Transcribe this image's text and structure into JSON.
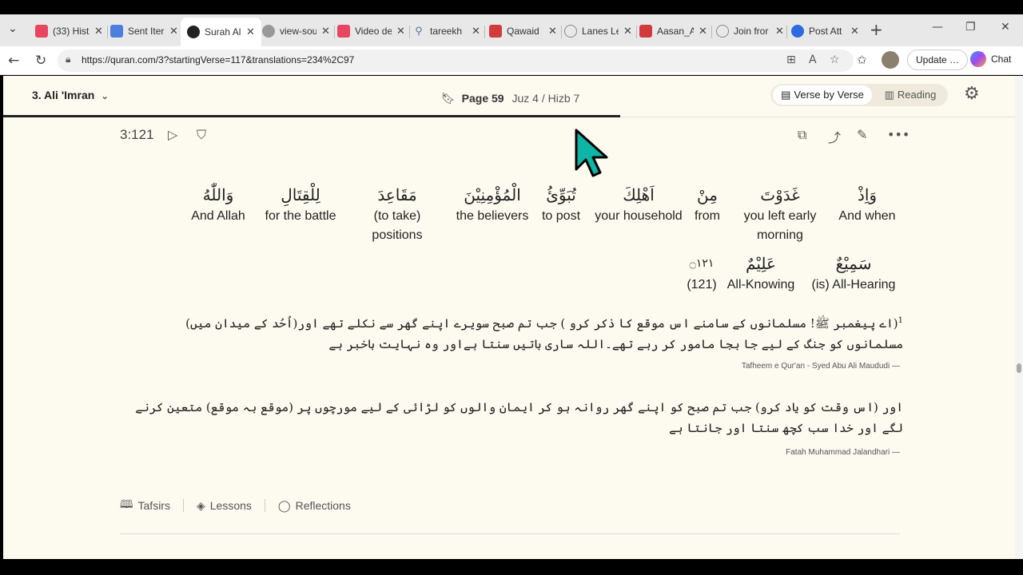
{
  "tabs": [
    {
      "label": "(33) Hist",
      "color": "#e8455e"
    },
    {
      "label": "Sent Iter",
      "color": "#4a7fe0"
    },
    {
      "label": "Surah Al",
      "color": "#222222"
    },
    {
      "label": "view-sou",
      "color": "#777777"
    },
    {
      "label": "Video de",
      "color": "#e8455e"
    },
    {
      "label": "tareekh",
      "color": "#5577aa"
    },
    {
      "label": "Qawaid",
      "color": "#d23b3b"
    },
    {
      "label": "Lanes Le",
      "color": "#888888"
    },
    {
      "label": "Aasan_A",
      "color": "#d23b3b"
    },
    {
      "label": "Join fror",
      "color": "#888888"
    },
    {
      "label": "Post Att",
      "color": "#2d6be0"
    }
  ],
  "address": {
    "url": "https://quran.com/3?startingVerse=117&translations=234%2C97"
  },
  "toolbar": {
    "update_label": "Update",
    "update_more": "…",
    "chat_label": "Chat"
  },
  "header": {
    "chapter": "3. Ali 'Imran",
    "page_label": "Page 59",
    "juz_label": "Juz 4 / Hizb 7",
    "mode_verse": "Verse by Verse",
    "mode_reading": "Reading",
    "progress_fraction": 0.61
  },
  "verse": {
    "key": "3:121",
    "words": [
      {
        "ar": "وَاِذْ",
        "en": "And when"
      },
      {
        "ar": "غَدَوْتَ",
        "en": "you left early morning"
      },
      {
        "ar": "مِنْ",
        "en": "from"
      },
      {
        "ar": "اَهْلِكَ",
        "en": "your household"
      },
      {
        "ar": "تُبَوِّئُ",
        "en": "to post"
      },
      {
        "ar": "الْمُؤْمِنِيْنَ",
        "en": "the believers"
      },
      {
        "ar": "مَقَاعِدَ",
        "en": "(to take) positions"
      },
      {
        "ar": "لِلْقِتَالِ",
        "en": "for the battle"
      },
      {
        "ar": "وَاللّٰهُ",
        "en": "And Allah"
      },
      {
        "ar": "سَمِيْعٌ",
        "en": "(is) All-Hearing"
      },
      {
        "ar": "عَلِيْمٌ",
        "en": "All-Knowing"
      },
      {
        "ar": "۝١٢١",
        "en": "(121)"
      }
    ]
  },
  "translations": [
    {
      "marker": "1",
      "text": "(اے پیغمبر ﷺ! مسلمانوں کے سامنے اس موقع کا ذکر کرو ) جب تم صبح سویرے اپنے گھر سے نکلے تھے اور(اُحُد کے میدان میں) مسلمانوں کو جنگ کے لیے جا بجا مامور کر رہے تھے۔اللہ ساری باتیں سنتا ہےاور وہ نہایت باخبر ہے",
      "credit": "Tafheem e Qur'an - Syed Abu Ali Maududi —"
    },
    {
      "marker": "",
      "text": "اور (اس وقت کو یاد کرو) جب تم صبح کو اپنے گھر روانہ ہو کر ایمان والوں کو لڑائی کے لیے مورچوں پر (موقع بہ موقع) متعین کرنے لگے اور خدا سب کچھ سنتا اور جانتا ہے",
      "credit": "Fatah Muhammad Jalandhari —"
    }
  ],
  "bottom_tabs": {
    "tafsirs": "Tafsirs",
    "lessons": "Lessons",
    "reflections": "Reflections"
  },
  "colors": {
    "page_bg": "#fdfaf0",
    "accent": "#222222",
    "cursor": "#0fb5a6"
  }
}
